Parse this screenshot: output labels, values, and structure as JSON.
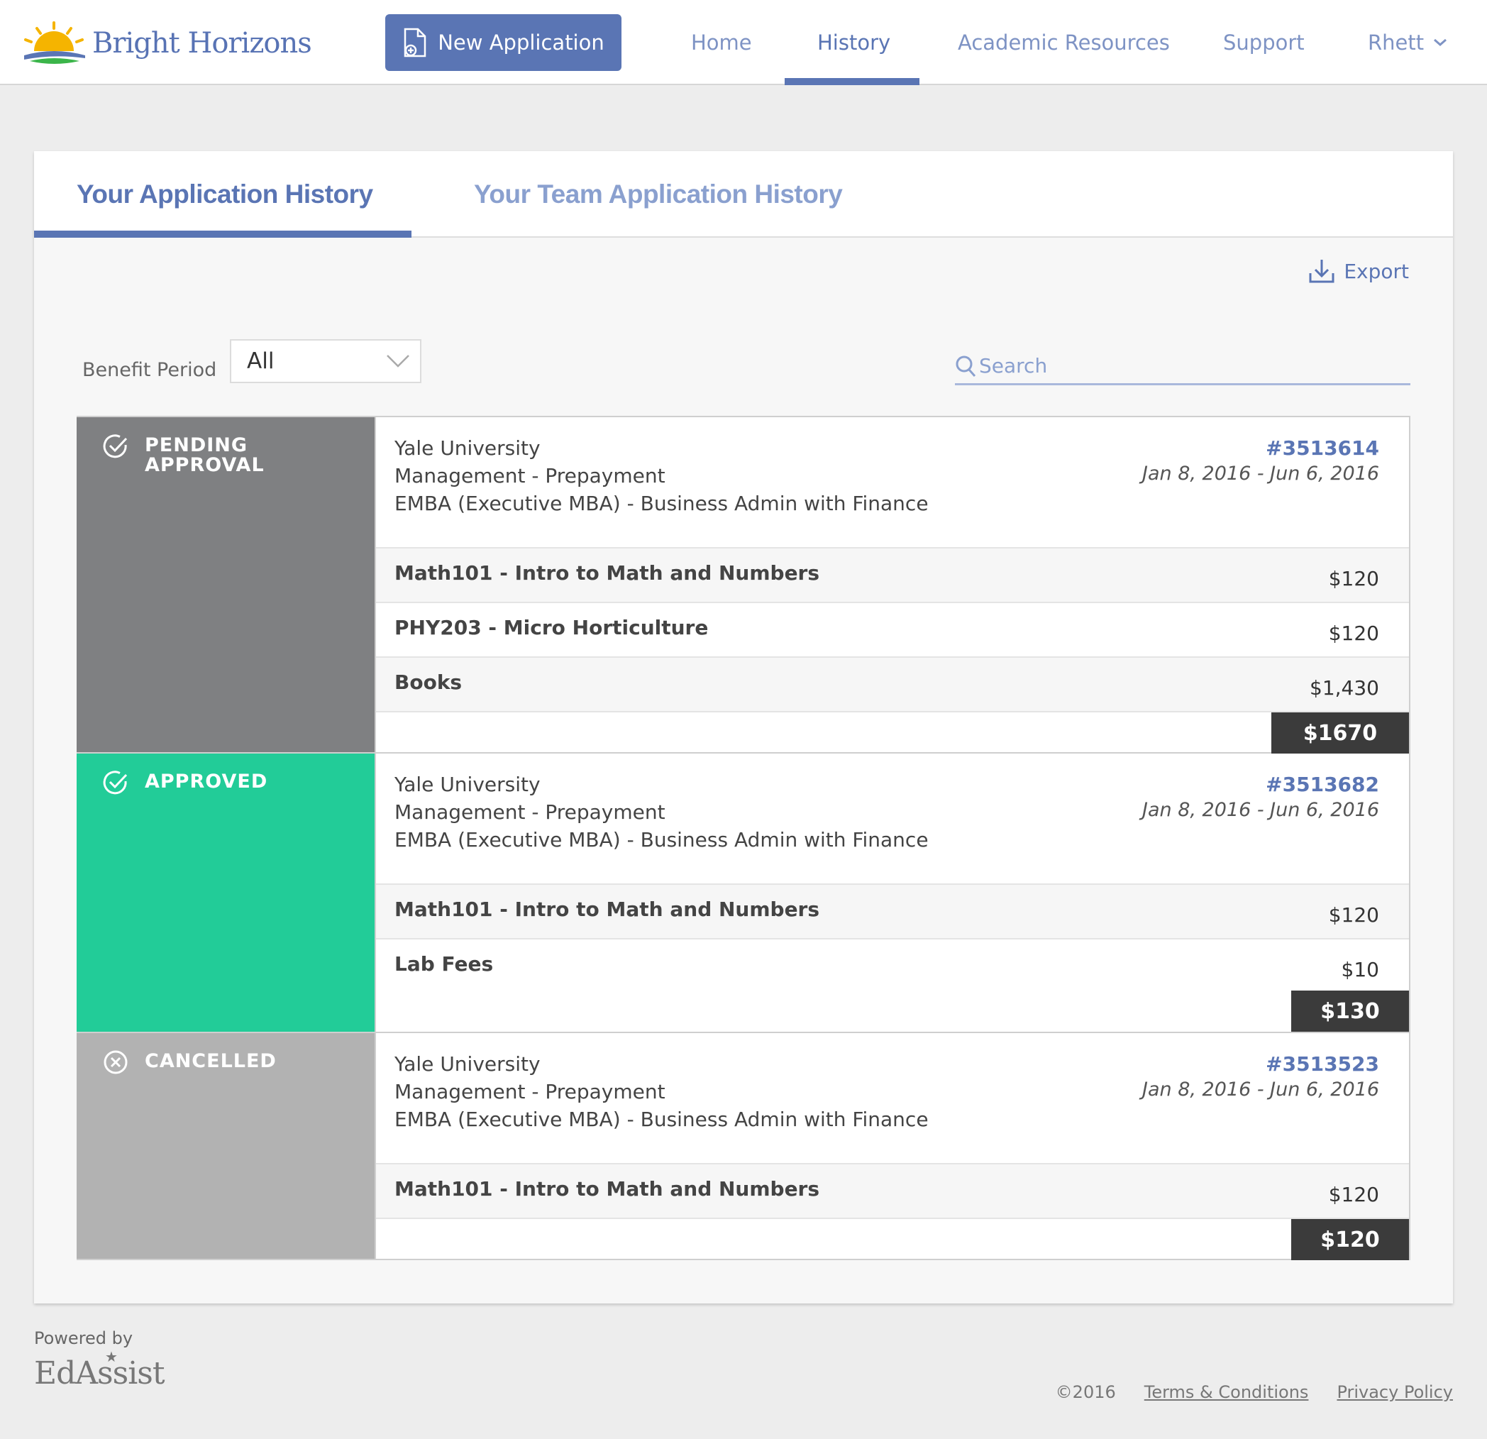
{
  "header": {
    "logo_text": "Bright Horizons",
    "new_application_label": "New Application",
    "nav": [
      {
        "label": "Home"
      },
      {
        "label": "History"
      },
      {
        "label": "Academic Resources"
      },
      {
        "label": "Support"
      },
      {
        "label": "Rhett"
      }
    ]
  },
  "tabs": [
    {
      "label": "Your Application History"
    },
    {
      "label": "Your Team Application History"
    }
  ],
  "toolbar": {
    "export_label": "Export",
    "benefit_period_label": "Benefit Period",
    "benefit_period_value": "All",
    "search_placeholder": "Search"
  },
  "applications": [
    {
      "status": "PENDING",
      "status2": "APPROVAL",
      "school": "Yale University",
      "payment": "Management - Prepayment",
      "program": "EMBA (Executive MBA) - Business Admin with Finance",
      "id": "#3513614",
      "dates": "Jan 8, 2016 - Jun 6, 2016",
      "items": [
        {
          "name": "Math101 - Intro to Math and Numbers",
          "amount": "$120"
        },
        {
          "name": "PHY203 - Micro Horticulture",
          "amount": "$120"
        },
        {
          "name": "Books",
          "amount": "$1,430"
        }
      ],
      "total": "$1670"
    },
    {
      "status": "APPROVED",
      "school": "Yale University",
      "payment": "Management - Prepayment",
      "program": "EMBA (Executive MBA) - Business Admin with Finance",
      "id": "#3513682",
      "dates": "Jan 8, 2016 - Jun 6, 2016",
      "items": [
        {
          "name": "Math101 - Intro to Math and Numbers",
          "amount": "$120"
        },
        {
          "name": "Lab Fees",
          "amount": "$10"
        }
      ],
      "total": "$130"
    },
    {
      "status": "CANCELLED",
      "school": "Yale University",
      "payment": "Management - Prepayment",
      "program": "EMBA (Executive MBA) - Business Admin with Finance",
      "id": "#3513523",
      "dates": "Jan 8, 2016 - Jun 6, 2016",
      "items": [
        {
          "name": "Math101 - Intro to Math and Numbers",
          "amount": "$120"
        }
      ],
      "total": "$120"
    }
  ],
  "footer": {
    "powered_by": "Powered by",
    "brand": "EdAssist",
    "copyright": "©2016",
    "terms": "Terms & Conditions",
    "privacy": "Privacy Policy"
  },
  "colors": {
    "accent": "#5a75b4",
    "pending": "#7f8082",
    "approved": "#22cc98",
    "cancelled": "#b2b2b2",
    "total_bg": "#3b3b3b"
  }
}
